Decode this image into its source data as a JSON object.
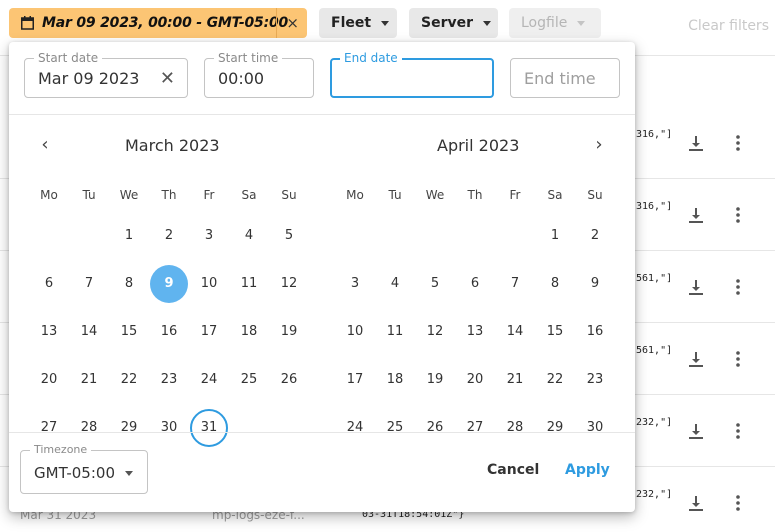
{
  "filterbar": {
    "date_chip_label": "Mar 09 2023, 00:00 - GMT-05:00",
    "date_chip_clear": "×",
    "fleet_label": "Fleet",
    "server_label": "Server",
    "logfile_label": "Logfile",
    "clear_filters_label": "Clear filters"
  },
  "rows": [
    {
      "code": "316,\"]"
    },
    {
      "code": "316,\"]"
    },
    {
      "code": "561,\"]"
    },
    {
      "code": "561,\"]"
    },
    {
      "code": "232,\"]"
    },
    {
      "code": "232,\"]"
    }
  ],
  "bottom_row": {
    "date": "Mar 31 2023",
    "source": "mp-logs-eze-f...",
    "code": "03-31T18:54:01Z\"}"
  },
  "picker": {
    "start_date": {
      "label": "Start date",
      "value": "Mar 09 2023",
      "clear": "✕"
    },
    "start_time": {
      "label": "Start time",
      "value": "00:00"
    },
    "end_date": {
      "label": "End date",
      "value": ""
    },
    "end_time": {
      "placeholder": "End time"
    },
    "nav_prev": "‹",
    "nav_next": "›",
    "weekdays": [
      "Mo",
      "Tu",
      "We",
      "Th",
      "Fr",
      "Sa",
      "Su"
    ],
    "months": [
      {
        "title": "March 2023",
        "weeks": [
          [
            "",
            "",
            "1",
            "2",
            "3",
            "4",
            "5"
          ],
          [
            "6",
            "7",
            "8",
            "9",
            "10",
            "11",
            "12"
          ],
          [
            "13",
            "14",
            "15",
            "16",
            "17",
            "18",
            "19"
          ],
          [
            "20",
            "21",
            "22",
            "23",
            "24",
            "25",
            "26"
          ],
          [
            "27",
            "28",
            "29",
            "30",
            "31",
            "",
            ""
          ]
        ],
        "selected_day": "9",
        "today_day": "31"
      },
      {
        "title": "April 2023",
        "weeks": [
          [
            "",
            "",
            "",
            "",
            "",
            "1",
            "2"
          ],
          [
            "3",
            "4",
            "5",
            "6",
            "7",
            "8",
            "9"
          ],
          [
            "10",
            "11",
            "12",
            "13",
            "14",
            "15",
            "16"
          ],
          [
            "17",
            "18",
            "19",
            "20",
            "21",
            "22",
            "23"
          ],
          [
            "24",
            "25",
            "26",
            "27",
            "28",
            "29",
            "30"
          ]
        ]
      }
    ],
    "timezone": {
      "label": "Timezone",
      "value": "GMT-05:00"
    },
    "cancel_label": "Cancel",
    "apply_label": "Apply"
  },
  "colors": {
    "chip_active": "#fcc574",
    "accent": "#2e9be0",
    "selected_day": "#60b4ef"
  },
  "icons": [
    "calendar-icon",
    "close-icon",
    "chevron-down-icon",
    "chevron-left-icon",
    "chevron-right-icon",
    "download-icon",
    "more-vert-icon"
  ]
}
